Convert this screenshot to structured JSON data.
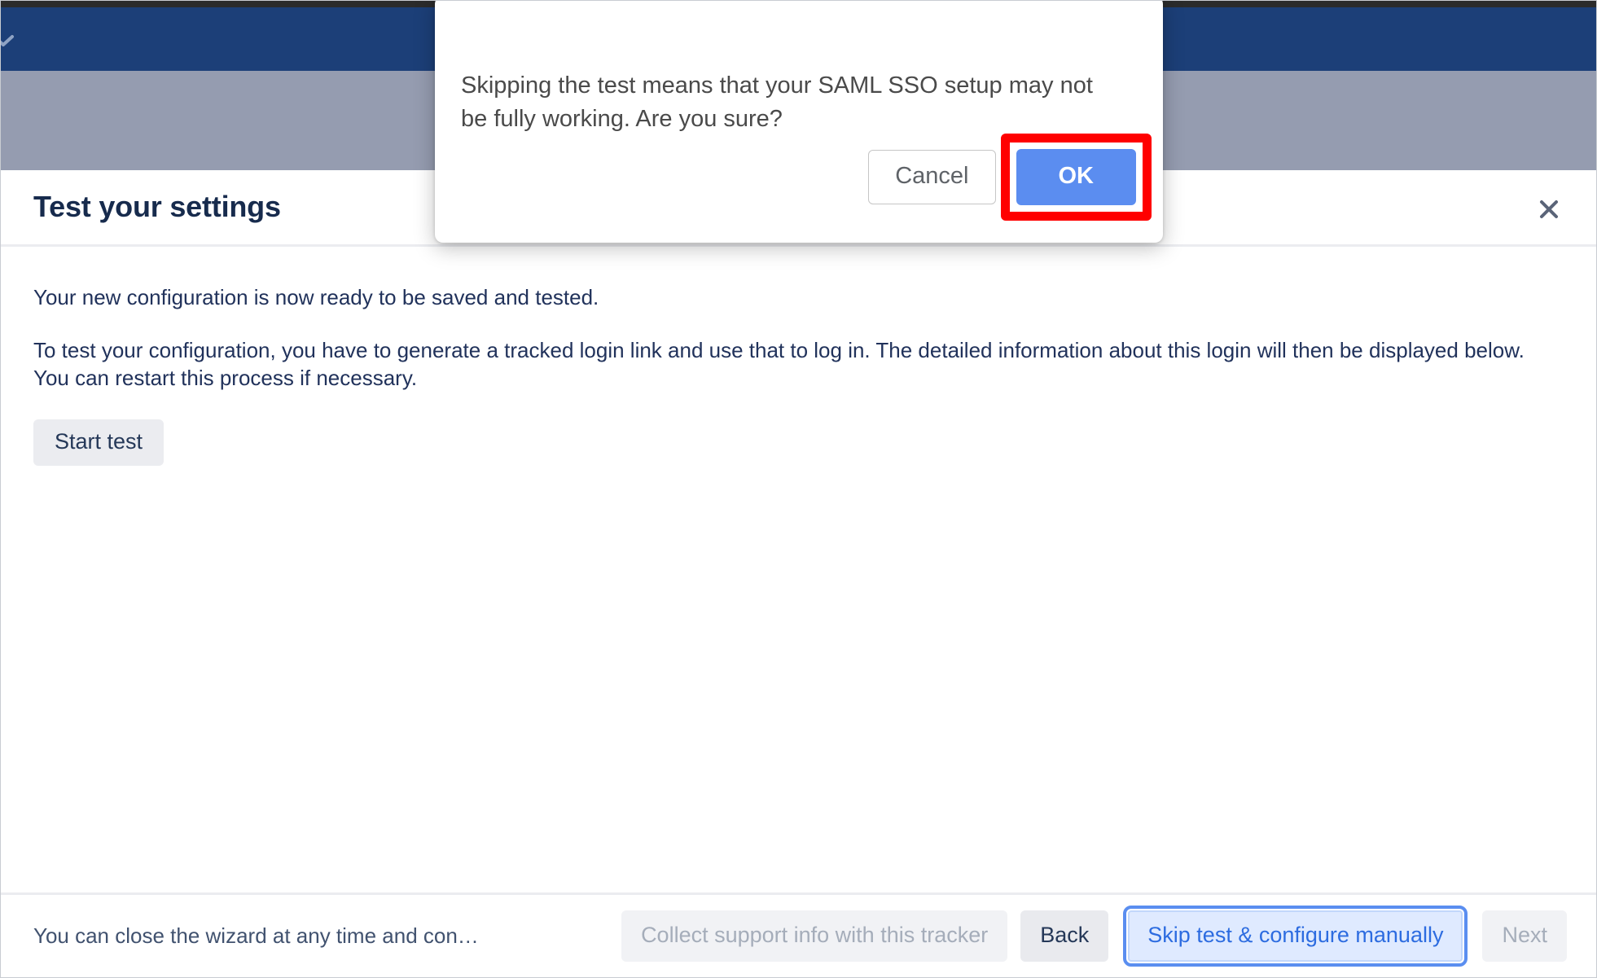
{
  "chrome": {
    "nav_chevron_icon": "chevron-down-icon"
  },
  "wizard": {
    "title": "Test your settings",
    "close_icon": "close-icon",
    "paragraph_1": "Your new configuration is now ready to be saved and tested.",
    "paragraph_2": "To test your configuration, you have to generate a tracked login link and use that to log in. The detailed information about this login will then be displayed below. You can restart this process if necessary.",
    "start_test_label": "Start test",
    "footer": {
      "note": "You can close the wizard at any time and con…",
      "collect_support_label": "Collect support info with this tracker",
      "back_label": "Back",
      "skip_label": "Skip test & configure manually",
      "next_label": "Next"
    }
  },
  "confirm_dialog": {
    "message": "Skipping the test means that your SAML SSO setup may not be fully working. Are you sure?",
    "cancel_label": "Cancel",
    "ok_label": "OK"
  },
  "colors": {
    "navbar": "#1c3f78",
    "subbar": "#959cb0",
    "title_text": "#172b4d",
    "body_text": "#21325b",
    "ok_button": "#5b8df0",
    "highlight_box": "#ff0000",
    "focus_ring": "#5a8ef0",
    "focus_fill": "#dfeaff",
    "focus_text": "#2d6ce0",
    "disabled_text": "#a5adba",
    "neutral_button": "#ebecf0"
  }
}
